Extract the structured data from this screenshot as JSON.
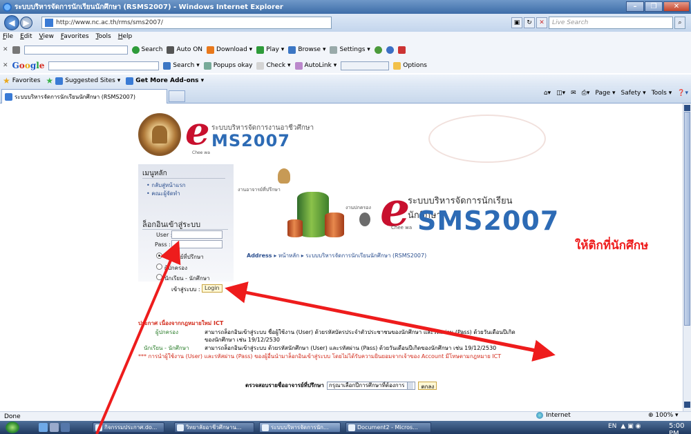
{
  "window": {
    "title": "ระบบบริหารจัดการนักเรียนนักศึกษา (RSMS2007) - Windows Internet Explorer"
  },
  "address_bar": {
    "url": "http://www.nc.ac.th/rms/sms2007/",
    "live_search_placeholder": "Live Search"
  },
  "menu": [
    "File",
    "Edit",
    "View",
    "Favorites",
    "Tools",
    "Help"
  ],
  "toolbar1": {
    "items": [
      "Search",
      "Auto ON",
      "Download ▾",
      "Play ▾",
      "Browse ▾",
      "Settings ▾"
    ]
  },
  "toolbar2": {
    "google": "Google",
    "items": [
      "Search ▾",
      "Popups okay",
      "Check ▾",
      "AutoLink ▾",
      "Options"
    ]
  },
  "favorites_bar": {
    "favorites": "Favorites",
    "suggested": "Suggested Sites ▾",
    "addons": "Get More Add-ons ▾"
  },
  "tab": {
    "label": "ระบบบริหารจัดการนักเรียนนักศึกษา (RSMS2007)"
  },
  "command_bar": {
    "page": "Page ▾",
    "safety": "Safety ▾",
    "tools": "Tools ▾"
  },
  "site": {
    "header_thai": "ระบบบริหารจัดการงานอาชีวศึกษา",
    "header_code": "MS2007",
    "chee": "Chee wa"
  },
  "sidebar": {
    "menu_title": "เมนูหลัก",
    "links": [
      "• กลับสู่หน้าแรก",
      "• คณะผู้จัดทำ"
    ],
    "login_title": "ล็อกอินเข้าสู่ระบบ",
    "user_label": "User :",
    "pass_label": "Pass :",
    "roles": [
      "อาจารย์ที่ปรึกษา",
      "ผู้ปกครอง",
      "นักเรียน - นักศึกษา"
    ],
    "login_prompt": "เข้าสู่ระบบ :",
    "login_button": "Login"
  },
  "banner": {
    "staff_caption": "งานอาจารย์ที่ปรึกษา",
    "parent_caption": "งานปกครอง",
    "title_thai": "ระบบบริหารจัดการนักเรียน นักศึกษา",
    "title_code": "SMS2007",
    "chee": "Chee wa"
  },
  "address_path": {
    "label": "Address ▸",
    "home": "หน้าหลัก ▸",
    "current": "ระบบบริหารจัดการนักเรียนนักศึกษา (RSMS2007)"
  },
  "notice": {
    "heading": "ประกาศ เนื่องจากกฎหมายใหม่ ICT",
    "parent_label": "ผู้ปกครอง",
    "parent_text1": "สามารถล็อกอินเข้าสู่ระบบ ชื่อผู้ใช้งาน (User) ด้วยรหัสบัตรประจำตัวประชาชนของนักศึกษา และรหัสผ่าน (Pass) ด้วยวันเดือนปีเกิด",
    "parent_text2": "ของนักศึกษา เช่น 19/12/2530",
    "student_label": "นักเรียน - นักศึกษา",
    "student_text": "สามารถล็อกอินเข้าสู่ระบบ ด้วยรหัสนักศึกษา (User) และรหัสผ่าน (Pass) ด้วยวันเดือนปีเกิดของนักศึกษา เช่น 19/12/2530",
    "warning": "*** การนำผู้ใช้งาน (User) และรหัสผ่าน (Pass) ของผู้อื่นนำมาล็อกอินเข้าสู่ระบบ โดยไม่ได้รับความยินยอมจากเจ้าของ Account มีโทษตามกฎหมาย ICT"
  },
  "advisor_check": {
    "label": "ตรวจสอบรายชื่ออาจารย์ที่ปรึกษา",
    "select_value": "กรุณาเลือกปีการศึกษาที่ต้องการ",
    "ok_button": "ตกลง"
  },
  "annotation": {
    "text": "ให้ติกที่นักศึกษ",
    "color": "#ee1c1c"
  },
  "status_bar": {
    "left": "Done",
    "zone": "Internet",
    "zoom": "100% ▾"
  },
  "taskbar": {
    "buttons": [
      "กิจกรรมประกาศ.do...",
      "วิทยาลัยอาชีวศึกษาน...",
      "ระบบบริหารจัดการนัก...",
      "Document2 - Micros..."
    ],
    "lang": "EN",
    "clock": "5:00 PM"
  }
}
